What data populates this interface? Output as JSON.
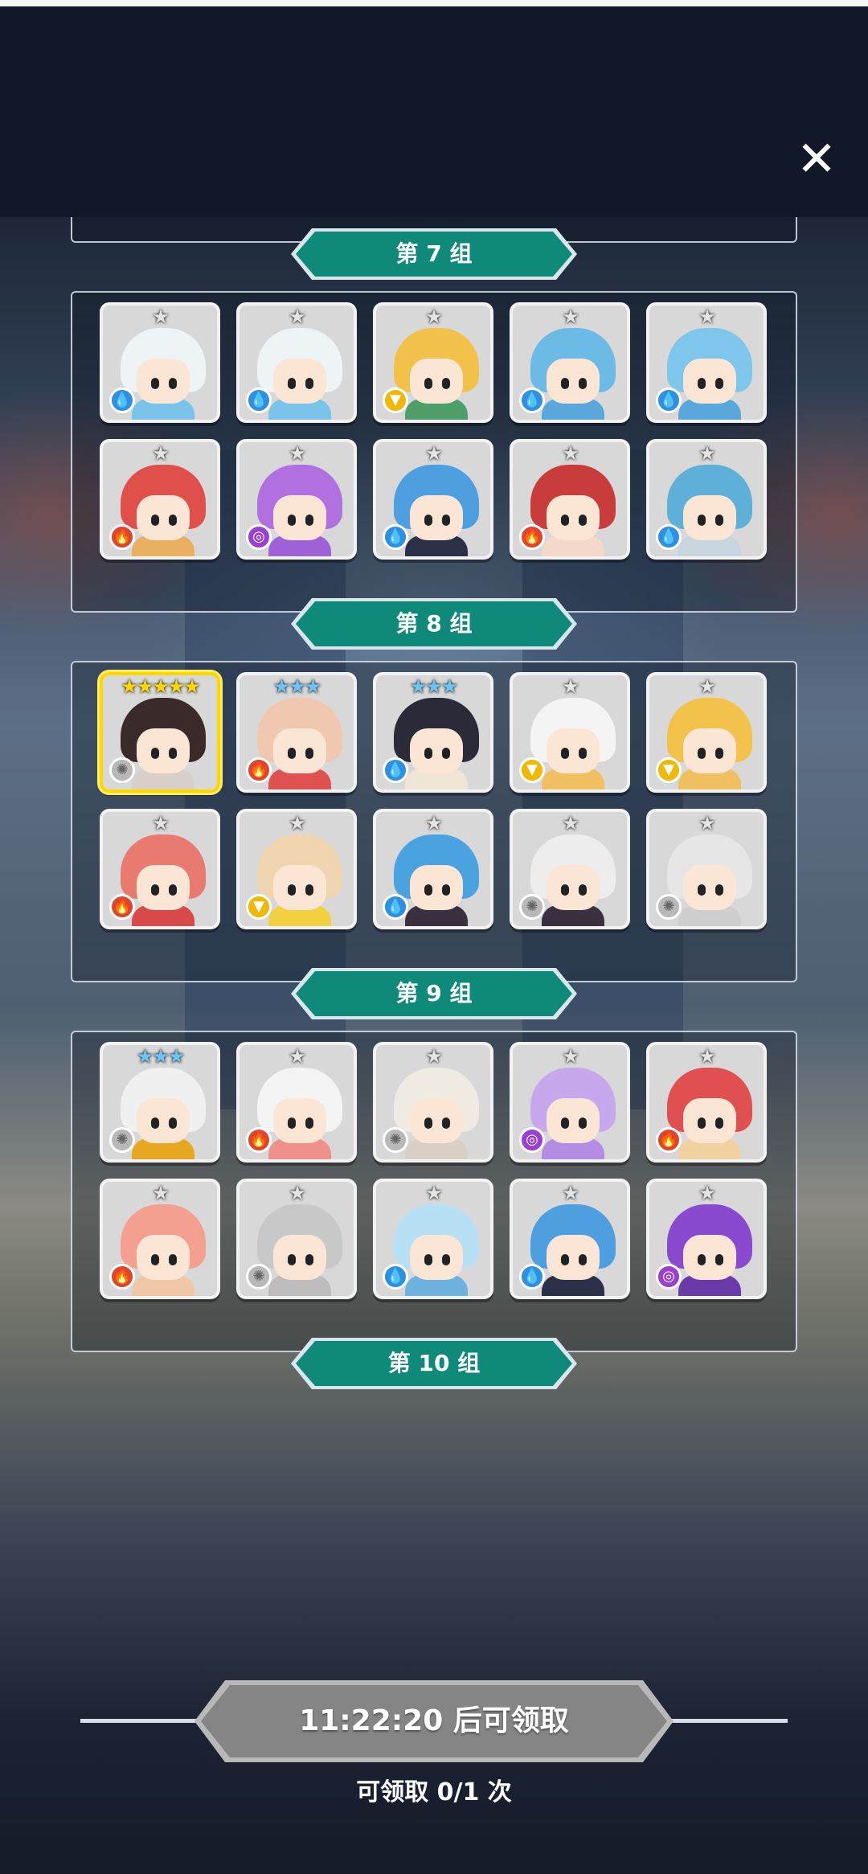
{
  "window": {
    "close_icon": "close-icon"
  },
  "groups": [
    {
      "label": "第 7 组",
      "cards": [
        {
          "stars": "★★★",
          "tier": 3,
          "element": "water",
          "glyph": "💧",
          "hair": "#2c3a66",
          "body": "#3e62c6"
        },
        {
          "stars": "★★★",
          "tier": 3,
          "element": "fire",
          "glyph": "🔥",
          "hair": "#e8726a",
          "body": "#d44a4a"
        },
        {
          "stars": "★★★",
          "tier": 3,
          "element": "water",
          "glyph": "💧",
          "hair": "#c79a62",
          "body": "#6fa8d8"
        },
        {
          "stars": "★★★",
          "tier": 3,
          "element": "water",
          "glyph": "💧",
          "hair": "#6a9be6",
          "body": "#e0b040"
        },
        {
          "stars": "★",
          "tier": 1,
          "element": "fire",
          "glyph": "🔥",
          "hair": "#e8505a",
          "body": "#e8505a"
        },
        {
          "stars": "★",
          "tier": 1,
          "element": "fire",
          "glyph": "🔥",
          "hair": "#f2b7a8",
          "body": "#f2b7a8"
        },
        {
          "stars": "★",
          "tier": 1,
          "element": "water",
          "glyph": "💧",
          "hair": "#8ed2ee",
          "body": "#9fd4ee"
        },
        {
          "stars": "★",
          "tier": 1,
          "element": "light",
          "glyph": "▼",
          "hair": "#4a3a34",
          "body": "#e9c24a"
        },
        {
          "stars": "★",
          "tier": 1,
          "element": "light",
          "glyph": "▼",
          "hair": "#2b2524",
          "body": "#e9c24a"
        },
        {
          "stars": "★",
          "tier": 1,
          "element": "water",
          "glyph": "💧",
          "hair": "#5aa8e0",
          "body": "#4a88cc"
        }
      ]
    },
    {
      "label": "第 8 组",
      "cards": [
        {
          "stars": "★",
          "tier": 1,
          "element": "water",
          "glyph": "💧",
          "hair": "#eef3f6",
          "body": "#7ac3e8"
        },
        {
          "stars": "★",
          "tier": 1,
          "element": "water",
          "glyph": "💧",
          "hair": "#eef3f6",
          "body": "#7ac3e8"
        },
        {
          "stars": "★",
          "tier": 1,
          "element": "light",
          "glyph": "▼",
          "hair": "#f2c14a",
          "body": "#4e9e6a"
        },
        {
          "stars": "★",
          "tier": 1,
          "element": "water",
          "glyph": "💧",
          "hair": "#6cbbe6",
          "body": "#5aa7dc"
        },
        {
          "stars": "★",
          "tier": 1,
          "element": "water",
          "glyph": "💧",
          "hair": "#7ec6ec",
          "body": "#5aa7dc"
        },
        {
          "stars": "★",
          "tier": 1,
          "element": "fire",
          "glyph": "🔥",
          "hair": "#e0504a",
          "body": "#e8b060"
        },
        {
          "stars": "★",
          "tier": 1,
          "element": "dark",
          "glyph": "◎",
          "hair": "#b070e0",
          "body": "#a062d8"
        },
        {
          "stars": "★",
          "tier": 1,
          "element": "water",
          "glyph": "💧",
          "hair": "#4e9fe0",
          "body": "#2b2f48"
        },
        {
          "stars": "★",
          "tier": 1,
          "element": "fire",
          "glyph": "🔥",
          "hair": "#c83c3c",
          "body": "#f4d8c8"
        },
        {
          "stars": "★",
          "tier": 1,
          "element": "water",
          "glyph": "💧",
          "hair": "#5fb0d8",
          "body": "#c8d4de"
        }
      ]
    },
    {
      "label": "第 9 组",
      "cards": [
        {
          "stars": "★★★★★",
          "tier": 5,
          "element": "holy",
          "glyph": "✺",
          "hair": "#3a2a2a",
          "body": "#d8d0c8",
          "gold": true
        },
        {
          "stars": "★★★",
          "tier": 3,
          "element": "fire",
          "glyph": "🔥",
          "hair": "#f0c8b0",
          "body": "#e05252"
        },
        {
          "stars": "★★★",
          "tier": 3,
          "element": "water",
          "glyph": "💧",
          "hair": "#2a2a38",
          "body": "#f0e6d6"
        },
        {
          "stars": "★",
          "tier": 1,
          "element": "light",
          "glyph": "▼",
          "hair": "#f4f4f4",
          "body": "#f0c060"
        },
        {
          "stars": "★",
          "tier": 1,
          "element": "light",
          "glyph": "▼",
          "hair": "#f2c24a",
          "body": "#f0c060"
        },
        {
          "stars": "★",
          "tier": 1,
          "element": "fire",
          "glyph": "🔥",
          "hair": "#e87a70",
          "body": "#d84a4a"
        },
        {
          "stars": "★",
          "tier": 1,
          "element": "light",
          "glyph": "▼",
          "hair": "#f0d6b0",
          "body": "#f2d040"
        },
        {
          "stars": "★",
          "tier": 1,
          "element": "water",
          "glyph": "💧",
          "hair": "#4aa2e0",
          "body": "#3a3040"
        },
        {
          "stars": "★",
          "tier": 1,
          "element": "holy",
          "glyph": "✺",
          "hair": "#ededed",
          "body": "#3a3040"
        },
        {
          "stars": "★",
          "tier": 1,
          "element": "holy",
          "glyph": "✺",
          "hair": "#e6e6e6",
          "body": "#cfcfcf"
        }
      ]
    },
    {
      "label": "第 10 组",
      "cards": [
        {
          "stars": "★★★",
          "tier": 3,
          "element": "holy",
          "glyph": "✺",
          "hair": "#f0f0f0",
          "body": "#e6a820"
        },
        {
          "stars": "★",
          "tier": 1,
          "element": "fire",
          "glyph": "🔥",
          "hair": "#f4f4f4",
          "body": "#f0908a"
        },
        {
          "stars": "★",
          "tier": 1,
          "element": "holy",
          "glyph": "✺",
          "hair": "#efeae2",
          "body": "#d8d0c4"
        },
        {
          "stars": "★",
          "tier": 1,
          "element": "dark",
          "glyph": "◎",
          "hair": "#c8a8ec",
          "body": "#b48ce4"
        },
        {
          "stars": "★",
          "tier": 1,
          "element": "fire",
          "glyph": "🔥",
          "hair": "#e05050",
          "body": "#f2d2a0"
        },
        {
          "stars": "★",
          "tier": 1,
          "element": "fire",
          "glyph": "🔥",
          "hair": "#f4a090",
          "body": "#f0c8a8"
        },
        {
          "stars": "★",
          "tier": 1,
          "element": "holy",
          "glyph": "✺",
          "hair": "#c8c8c8",
          "body": "#bcbcbc"
        },
        {
          "stars": "★",
          "tier": 1,
          "element": "water",
          "glyph": "💧",
          "hair": "#b8e0f4",
          "body": "#6fb2e0"
        },
        {
          "stars": "★",
          "tier": 1,
          "element": "water",
          "glyph": "💧",
          "hair": "#4e9fe0",
          "body": "#2b2f48"
        },
        {
          "stars": "★",
          "tier": 1,
          "element": "dark",
          "glyph": "◎",
          "hair": "#8a4ad0",
          "body": "#6a3aa8"
        }
      ]
    }
  ],
  "claim": {
    "button_label": "11:22:20 后可领取",
    "count_text": "可领取 0/1 次"
  },
  "colors": {
    "ribbon": "#0f8a7a",
    "ribbon_edge": "#d8e6ee",
    "button": "#858585",
    "button_edge": "#b8b8b8"
  }
}
